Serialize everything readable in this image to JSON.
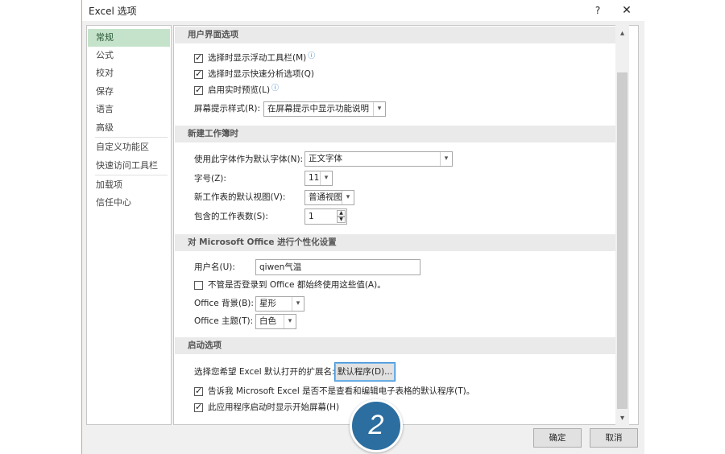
{
  "window": {
    "title": "Excel 选项",
    "help_label": "?",
    "close_label": "✕"
  },
  "nav": {
    "items": [
      {
        "label": "常规",
        "selected": true
      },
      {
        "label": "公式"
      },
      {
        "label": "校对"
      },
      {
        "label": "保存"
      },
      {
        "label": "语言"
      },
      {
        "label": "高级"
      },
      {
        "label": "自定义功能区"
      },
      {
        "label": "快速访问工具栏"
      },
      {
        "label": "加载项"
      },
      {
        "label": "信任中心"
      }
    ]
  },
  "ui_options": {
    "header": "用户界面选项",
    "mini_toolbar": {
      "label": "选择时显示浮动工具栏(M)",
      "checked": true
    },
    "quick_analysis": {
      "label": "选择时显示快速分析选项(Q)",
      "checked": true
    },
    "live_preview": {
      "label": "启用实时预览(L)",
      "checked": true
    },
    "screentip_style": {
      "label": "屏幕提示样式(R):",
      "value": "在屏幕提示中显示功能说明"
    }
  },
  "new_workbook": {
    "header": "新建工作簿时",
    "default_font": {
      "label": "使用此字体作为默认字体(N):",
      "value": "正文字体"
    },
    "font_size": {
      "label": "字号(Z):",
      "value": "11"
    },
    "default_view": {
      "label": "新工作表的默认视图(V):",
      "value": "普通视图"
    },
    "sheet_count": {
      "label": "包含的工作表数(S):",
      "value": "1"
    }
  },
  "personalize": {
    "header": "对 Microsoft Office 进行个性化设置",
    "username": {
      "label": "用户名(U):",
      "value": "qiwen气温"
    },
    "always_use": {
      "label": "不管是否登录到 Office 都始终使用这些值(A)。",
      "checked": false
    },
    "background": {
      "label": "Office 背景(B):",
      "value": "星形"
    },
    "theme": {
      "label": "Office 主题(T):",
      "value": "白色"
    }
  },
  "startup": {
    "header": "启动选项",
    "extensions_label": "选择您希望 Excel 默认打开的扩展名:",
    "default_programs_button": "默认程序(D)...",
    "tell_me": {
      "label": "告诉我 Microsoft Excel 是否不是查看和编辑电子表格的默认程序(T)。",
      "checked": true
    },
    "show_start_screen": {
      "label": "此应用程序启动时显示开始屏幕(H)",
      "checked": true
    }
  },
  "footer": {
    "ok_label": "确定",
    "cancel_label": "取消"
  },
  "step_badge": "2",
  "icons": {
    "info": "ⓘ",
    "checkmark": "✓",
    "dropdown": "▾",
    "scroll_up": "▴",
    "scroll_down": "▾",
    "spin_up": "▲",
    "spin_down": "▼"
  }
}
